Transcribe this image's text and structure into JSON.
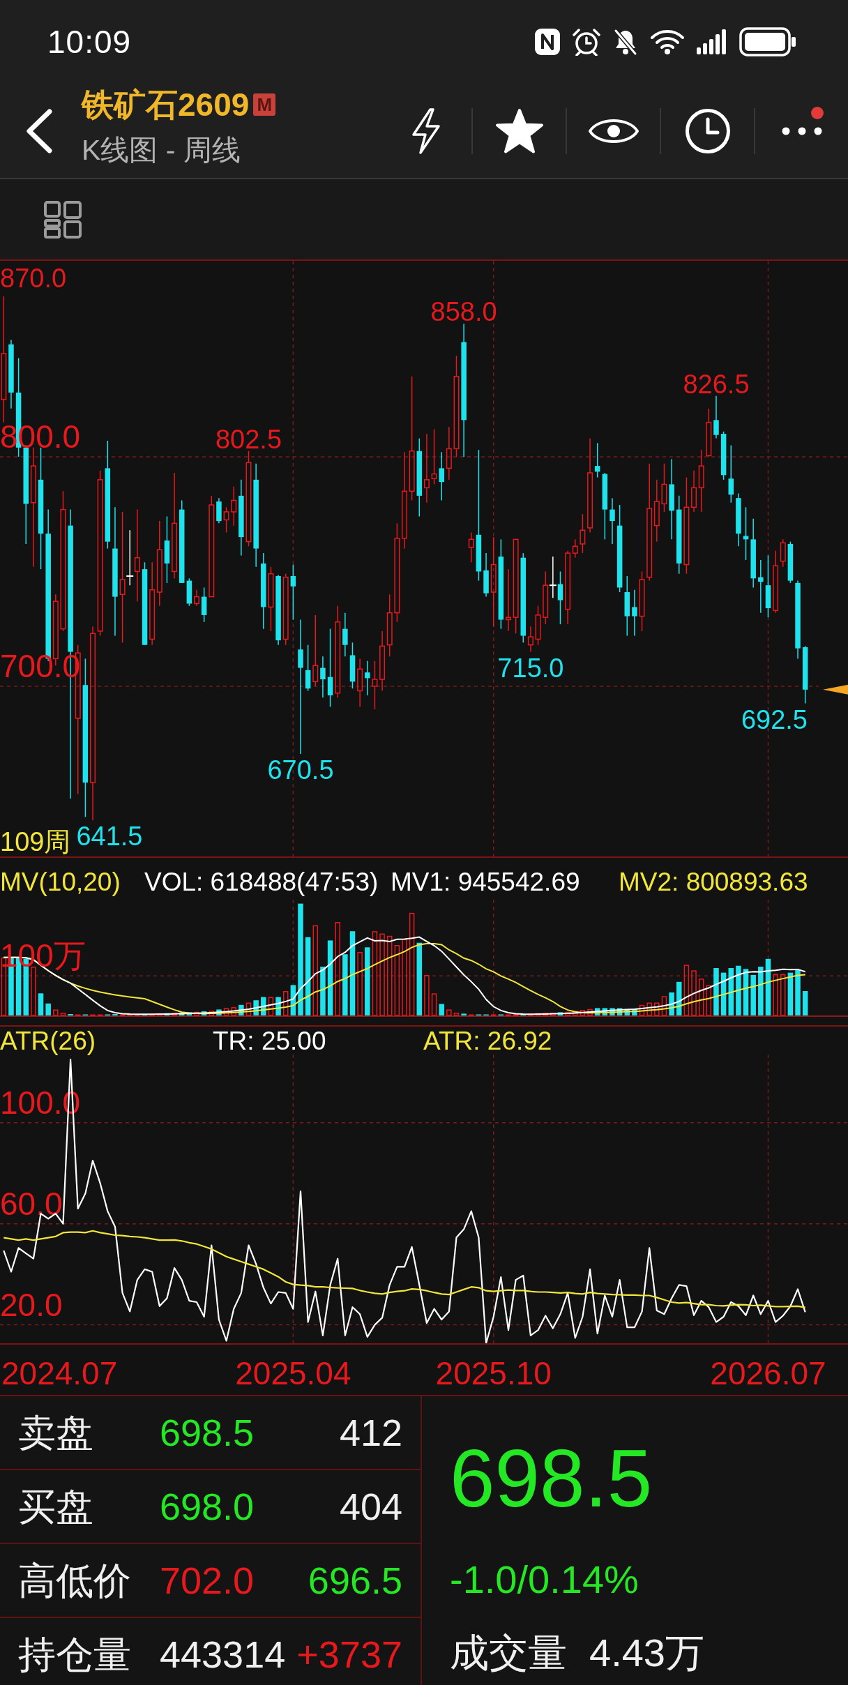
{
  "status_bar": {
    "time": "10:09"
  },
  "header": {
    "title": "铁矿石2609",
    "badge": "M",
    "subtitle": "K线图 - 周线",
    "more_notification": true
  },
  "price_chart": {
    "chart_data": {
      "type": "candlestick",
      "ylim": [
        625.8,
        885.4
      ],
      "grid": true,
      "yticks": [
        {
          "value": 870,
          "label": "870.0"
        },
        {
          "value": 800,
          "label": "800.0"
        },
        {
          "value": 700,
          "label": "700.0"
        }
      ],
      "ohlc": [
        [
          825,
          870,
          815,
          845
        ],
        [
          849,
          851,
          821,
          828
        ],
        [
          828,
          843,
          800,
          804
        ],
        [
          804,
          805,
          762,
          779.5
        ],
        [
          780,
          804,
          752,
          796
        ],
        [
          790,
          804,
          751,
          766.5
        ],
        [
          766.5,
          777,
          711,
          712
        ],
        [
          712,
          740,
          709,
          737
        ],
        [
          725,
          785,
          724,
          777
        ],
        [
          770,
          777,
          651,
          715
        ],
        [
          686,
          718,
          653,
          714.5
        ],
        [
          700.5,
          712,
          643,
          658
        ],
        [
          658,
          726,
          641.5,
          723
        ],
        [
          724,
          794,
          722,
          790
        ],
        [
          795,
          807,
          760,
          763
        ],
        [
          760,
          778,
          722,
          739
        ],
        [
          740,
          776,
          719,
          746.5
        ],
        [
          748,
          768,
          744,
          748
        ],
        [
          750,
          777,
          737,
          756
        ],
        [
          751,
          754,
          718,
          718
        ],
        [
          720.5,
          754,
          718,
          742
        ],
        [
          741,
          772,
          735,
          759.5
        ],
        [
          763.5,
          774,
          745,
          753.5
        ],
        [
          750,
          793,
          747,
          771
        ],
        [
          777,
          781,
          745,
          745
        ],
        [
          746,
          747,
          735,
          736
        ],
        [
          736,
          742,
          735,
          739
        ],
        [
          739,
          743,
          728,
          731
        ],
        [
          739,
          783,
          739,
          779
        ],
        [
          780.5,
          782,
          771,
          772
        ],
        [
          772.5,
          778,
          767,
          776
        ],
        [
          776,
          787,
          770,
          781
        ],
        [
          783,
          790,
          757,
          765
        ],
        [
          763,
          802.5,
          761,
          797.5
        ],
        [
          790,
          797,
          752,
          760
        ],
        [
          753.5,
          758,
          725,
          734.5
        ],
        [
          734.5,
          752,
          724,
          749
        ],
        [
          748,
          748.5,
          718,
          720
        ],
        [
          720.5,
          749,
          718,
          747.5
        ],
        [
          748,
          753,
          729,
          743.5
        ],
        [
          716,
          729,
          670.5,
          708
        ],
        [
          707,
          718,
          698,
          699
        ],
        [
          702,
          731,
          700,
          709
        ],
        [
          708,
          713,
          695,
          703
        ],
        [
          704,
          725,
          691,
          696
        ],
        [
          697,
          735,
          695,
          728
        ],
        [
          725,
          732,
          713,
          718
        ],
        [
          713.5,
          719,
          699,
          702
        ],
        [
          698,
          712,
          691,
          707.5
        ],
        [
          706,
          711,
          696,
          703.5
        ],
        [
          700,
          711,
          690,
          703
        ],
        [
          703,
          724,
          698,
          717.5
        ],
        [
          718,
          740,
          713,
          732
        ],
        [
          732,
          771,
          728,
          764.5
        ],
        [
          764.5,
          802,
          760,
          785
        ],
        [
          785,
          835,
          781,
          802.5
        ],
        [
          802.5,
          808,
          774,
          783
        ],
        [
          786.5,
          810,
          780,
          790
        ],
        [
          790.5,
          812,
          788,
          792.5
        ],
        [
          795,
          802,
          781,
          789
        ],
        [
          795,
          813,
          790,
          803.5
        ],
        [
          803.5,
          844,
          800,
          835
        ],
        [
          850,
          858,
          800,
          816
        ],
        [
          760.5,
          767,
          754,
          764
        ],
        [
          766,
          803,
          746,
          750
        ],
        [
          750.5,
          758,
          739,
          740.5
        ],
        [
          741,
          765,
          726,
          753
        ],
        [
          756.5,
          764,
          725,
          729
        ],
        [
          729,
          751,
          724,
          730
        ],
        [
          730,
          764,
          723,
          764
        ],
        [
          756,
          758,
          719,
          722
        ],
        [
          718,
          726,
          715,
          721.5
        ],
        [
          720.5,
          735,
          718,
          731
        ],
        [
          730,
          750,
          727,
          744
        ],
        [
          744,
          756.5,
          738.5,
          744
        ],
        [
          744.5,
          750,
          727,
          737.5
        ],
        [
          733.5,
          759,
          727,
          758
        ],
        [
          758,
          764,
          756,
          761
        ],
        [
          762,
          775,
          758,
          768
        ],
        [
          769,
          808,
          767,
          793
        ],
        [
          796,
          806,
          791,
          793.5
        ],
        [
          792.5,
          793,
          764,
          777
        ],
        [
          777,
          782,
          762,
          772
        ],
        [
          770,
          779,
          741,
          743
        ],
        [
          741,
          748,
          722,
          730.5
        ],
        [
          734.5,
          742,
          722,
          730.5
        ],
        [
          730.5,
          750,
          724,
          746.5
        ],
        [
          747.5,
          797,
          746,
          777.5
        ],
        [
          770,
          790,
          763,
          780.5
        ],
        [
          779.5,
          797,
          776,
          788
        ],
        [
          788,
          799,
          764,
          776.5
        ],
        [
          777,
          783,
          749,
          753.5
        ],
        [
          753,
          791,
          749,
          778
        ],
        [
          778,
          794,
          776,
          786.5
        ],
        [
          786.5,
          803,
          776,
          796
        ],
        [
          800.5,
          821,
          800,
          815
        ],
        [
          816,
          826.5,
          808,
          809.5
        ],
        [
          810,
          811,
          790,
          792
        ],
        [
          790.5,
          805,
          780,
          783.5
        ],
        [
          782,
          784,
          761,
          766.5
        ],
        [
          765.5,
          778,
          755,
          764
        ],
        [
          764,
          773,
          743,
          747
        ],
        [
          747.5,
          755,
          732,
          745.5
        ],
        [
          744,
          757,
          730,
          734
        ],
        [
          733,
          759,
          732,
          752.5
        ],
        [
          754.5,
          764,
          752,
          762.5
        ],
        [
          762,
          763,
          745,
          746
        ],
        [
          745,
          746,
          712,
          716.5
        ],
        [
          717,
          717.5,
          692.5,
          698.5
        ]
      ],
      "annotations": [
        "858.0",
        "802.5",
        "826.5",
        "670.5",
        "715.0",
        "692.5",
        "641.5"
      ]
    },
    "period_label": "109周"
  },
  "volume_panel": {
    "readings": [
      {
        "text": "MV(10,20)",
        "color": "#f3e63a"
      },
      {
        "text": "VOL: 618488(47:53)",
        "color": "#ffffff"
      },
      {
        "text": "MV1: 945542.69",
        "color": "#ffffff"
      },
      {
        "text": "MV2: 800893.63",
        "color": "#f3e63a"
      }
    ],
    "y_label": "100万"
  },
  "atr_panel": {
    "readings": [
      {
        "text": "ATR(26)",
        "color": "#f3e63a"
      },
      {
        "text": "TR: 25.00",
        "color": "#ffffff"
      },
      {
        "text": "ATR: 26.92",
        "color": "#f3e63a"
      }
    ],
    "chart_data": {
      "type": "line",
      "ylim": [
        12.7,
        127
      ],
      "grid": true,
      "yticks": [
        {
          "value": 100,
          "label": "100.0"
        },
        {
          "value": 60,
          "label": "60.0"
        },
        {
          "value": 20,
          "label": "20.0"
        }
      ],
      "series": [
        {
          "color": "#ffffff",
          "values": [
            49.4,
            41,
            50.4,
            48.3,
            46.2,
            64,
            62,
            64,
            60,
            125,
            66,
            72,
            85,
            76,
            65,
            58.8,
            32.6,
            25.3,
            37.8,
            42,
            41,
            27.4,
            30.5,
            42.5,
            37.8,
            29.5,
            29,
            23.2,
            51.5,
            22.1,
            13.7,
            26.3,
            32.6,
            51.5,
            44.1,
            34.7,
            28.4,
            33,
            32.6,
            26.3,
            72.9,
            21.1,
            33.2,
            15.8,
            35.8,
            46.2,
            15.8,
            27,
            24.2,
            15.2,
            20,
            22.8,
            35.8,
            43,
            43,
            50.8,
            35.8,
            20.7,
            26.3,
            22.1,
            25.3,
            54.6,
            57.8,
            65,
            54.6,
            12.7,
            23.2,
            38.9,
            17.9,
            37.8,
            39.5,
            15.8,
            17.9,
            23.6,
            18.6,
            24.2,
            32.6,
            14.8,
            23.2,
            42,
            16.5,
            31.6,
            23.2,
            37.8,
            19,
            19,
            25.3,
            50.4,
            25.7,
            24.2,
            30.5,
            35.8,
            35.3,
            23.8,
            29.5,
            27,
            21.1,
            23.2,
            29,
            27.4,
            23.8,
            31.6,
            24.2,
            29.5,
            21.1,
            23.6,
            27.4,
            34.1,
            25
          ]
        },
        {
          "color": "#f3e63a",
          "values": [
            54.5,
            54,
            53.5,
            54,
            53.5,
            54,
            54.5,
            55,
            56.5,
            56.7,
            56.7,
            56.5,
            57.2,
            56.5,
            56,
            55.5,
            55.3,
            55,
            54.8,
            54.5,
            54,
            53.5,
            53.5,
            53.6,
            53.2,
            52.5,
            52,
            51,
            50,
            48.5,
            47,
            46,
            45,
            44,
            43,
            42,
            40.5,
            39,
            37,
            36,
            35.7,
            35.5,
            35,
            35,
            34.8,
            34.6,
            34.5,
            34.4,
            33.6,
            33,
            32.5,
            32.2,
            32.8,
            33.2,
            33.5,
            34.2,
            34,
            33.5,
            32.8,
            32.2,
            32,
            33,
            34,
            35,
            34.7,
            33.5,
            33.2,
            33.5,
            33.8,
            33.6,
            33.6,
            33.2,
            33,
            33,
            32.8,
            32.6,
            32.8,
            32.4,
            32.2,
            32.8,
            32.4,
            32.2,
            32,
            31.9,
            31.8,
            31.8,
            31.6,
            31.6,
            30.8,
            29.9,
            29,
            28.6,
            28.8,
            28.4,
            28,
            28,
            27.6,
            27.5,
            27.8,
            28,
            27.9,
            27.6,
            27.8,
            27.5,
            27.2,
            27.2,
            27.3,
            27.4,
            26.9
          ]
        }
      ]
    }
  },
  "date_axis": [
    "2024.07",
    "2025.04",
    "2025.10",
    "2026.07"
  ],
  "quote": {
    "rows": [
      {
        "label": "卖盘",
        "cells": [
          {
            "text": "698.5",
            "color": "#25e825"
          },
          {
            "text": "412",
            "color": "#f0f0f0"
          }
        ]
      },
      {
        "label": "买盘",
        "cells": [
          {
            "text": "698.0",
            "color": "#25e825"
          },
          {
            "text": "404",
            "color": "#f0f0f0"
          }
        ]
      },
      {
        "label": "高低价",
        "cells": [
          {
            "text": "702.0",
            "color": "#e8191c"
          },
          {
            "text": "696.5",
            "color": "#25e825"
          }
        ]
      },
      {
        "label": "持仓量",
        "cells": [
          {
            "text": "443314",
            "color": "#f0f0f0"
          },
          {
            "text": "+3737",
            "color": "#e8191c"
          }
        ]
      }
    ],
    "last_price": {
      "text": "698.5",
      "color": "#25e825"
    },
    "change": {
      "text": "-1.0/0.14%",
      "color": "#25e825"
    },
    "volume_label": "成交量",
    "volume": "4.43万"
  }
}
